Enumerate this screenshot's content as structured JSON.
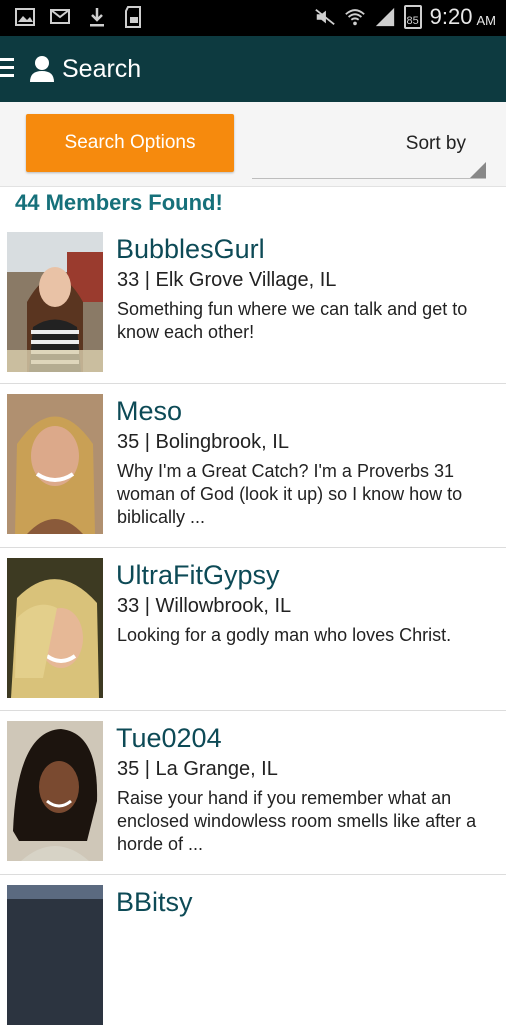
{
  "status_bar": {
    "battery": "85",
    "time": "9:20",
    "ampm": "AM"
  },
  "header": {
    "title": "Search"
  },
  "search": {
    "options_label": "Search Options",
    "sort_label": "Sort by"
  },
  "results": {
    "count_label": "44 Members Found!"
  },
  "members": [
    {
      "name": "BubblesGurl",
      "location": "33 | Elk Grove Village, IL",
      "description": "Something fun where we can talk and get to know each other!"
    },
    {
      "name": "Meso",
      "location": "35 | Bolingbrook, IL",
      "description": "Why I'm a Great Catch? I'm a Proverbs 31 woman of God (look it up) so I know how to biblically ..."
    },
    {
      "name": "UltraFitGypsy",
      "location": "33 | Willowbrook, IL",
      "description": "Looking for a godly man who loves Christ."
    },
    {
      "name": "Tue0204",
      "location": "35 | La Grange, IL",
      "description": "Raise your hand if you remember what an enclosed windowless room smells like after a horde of ..."
    },
    {
      "name": "BBitsy",
      "location": "",
      "description": ""
    }
  ],
  "colors": {
    "app_bar": "#0d3a40",
    "accent_orange": "#f68a0d",
    "teal_text": "#16707a"
  }
}
